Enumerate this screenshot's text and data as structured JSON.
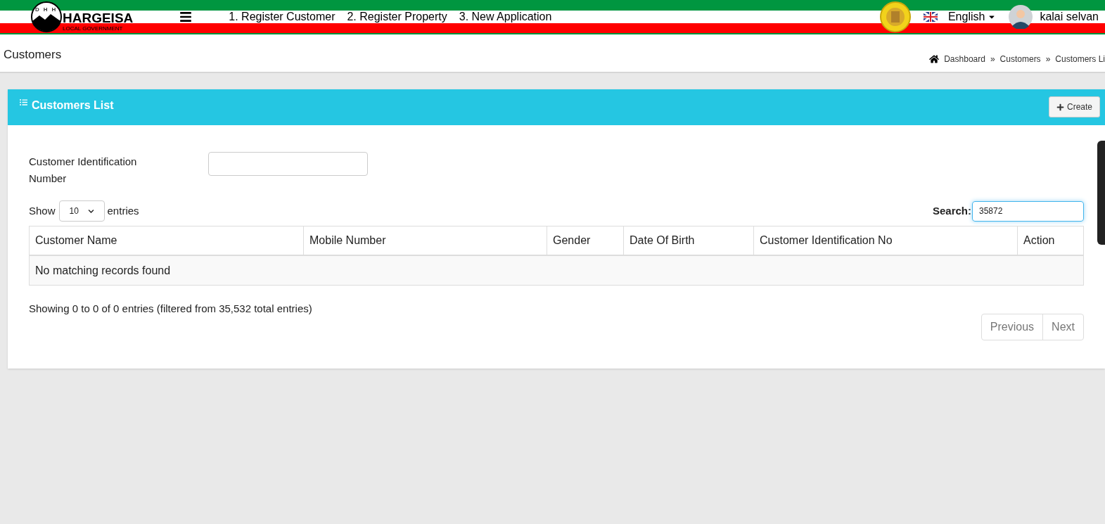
{
  "header": {
    "logo": {
      "title": "HARGEISA",
      "subtitle": "LOCAL GOVERNMENT",
      "letters": [
        "D",
        "H",
        "H"
      ]
    },
    "nav_links": [
      "1. Register Customer",
      "2. Register Property",
      "3. New Application"
    ],
    "language": "English",
    "user": "kalai selvan"
  },
  "page_title": "Customers",
  "breadcrumb": [
    {
      "label": "Dashboard"
    },
    {
      "separator": "»",
      "label": "Customers"
    },
    {
      "separator": "»",
      "label": "Customers Li"
    }
  ],
  "panel": {
    "title": "Customers List",
    "create_button": "Create",
    "filter": {
      "label": "Customer Identification Number"
    },
    "length": {
      "show": "Show",
      "value": "10",
      "entries": "entries"
    },
    "search": {
      "label": "Search:",
      "value": "35872"
    },
    "table": {
      "columns": [
        "Customer Name",
        "Mobile Number",
        "Gender",
        "Date Of Birth",
        "Customer Identification No",
        "Action"
      ],
      "empty_message": "No matching records found"
    },
    "info": "Showing 0 to 0 of 0 entries (filtered from 35,532 total entries)",
    "pagination": [
      {
        "label": "Previous",
        "disabled": true
      },
      {
        "label": "Next",
        "disabled": true
      }
    ]
  }
}
